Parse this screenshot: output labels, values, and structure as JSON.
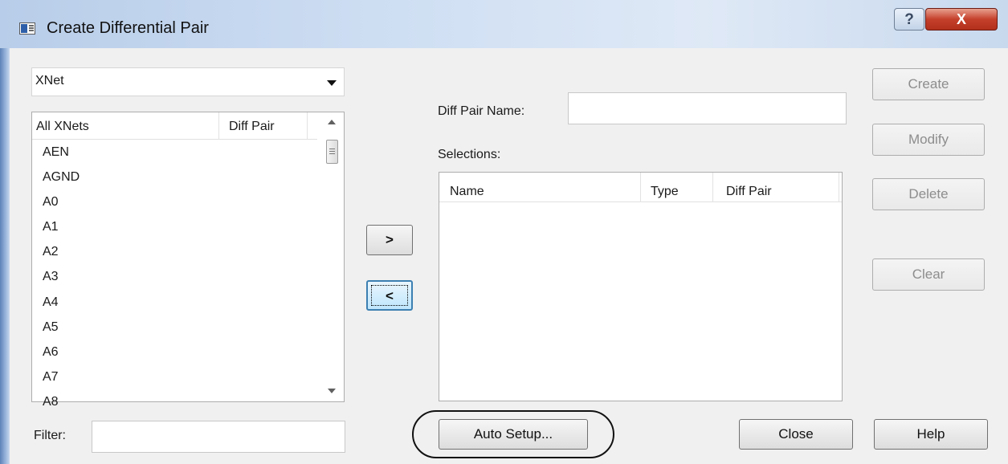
{
  "window": {
    "title": "Create Differential Pair",
    "help_glyph": "?",
    "close_glyph": "X"
  },
  "net_type": {
    "selected": "XNet"
  },
  "xnet_list": {
    "col_all": "All XNets",
    "col_diff": "Diff Pair",
    "items": [
      "AEN",
      "AGND",
      "A0",
      "A1",
      "A2",
      "A3",
      "A4",
      "A5",
      "A6",
      "A7",
      "A8"
    ]
  },
  "filter": {
    "label": "Filter:",
    "value": ""
  },
  "move": {
    "add_label": ">",
    "remove_label": "<"
  },
  "diff_pair_name": {
    "label": "Diff Pair Name:",
    "value": ""
  },
  "selections": {
    "label": "Selections:",
    "col_name": "Name",
    "col_type": "Type",
    "col_diff": "Diff Pair"
  },
  "actions": {
    "create": "Create",
    "modify": "Modify",
    "delete": "Delete",
    "clear": "Clear",
    "auto_setup": "Auto Setup...",
    "close": "Close",
    "help": "Help"
  }
}
